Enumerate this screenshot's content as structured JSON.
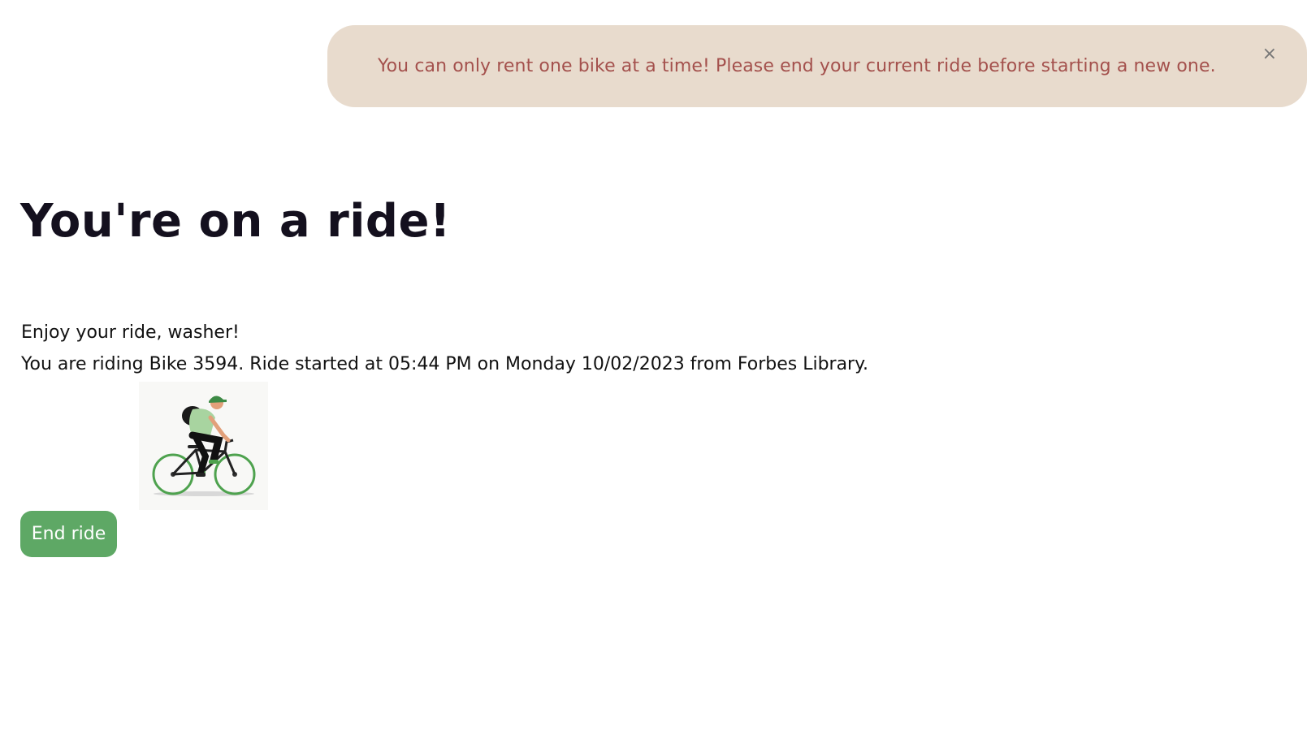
{
  "alert": {
    "message": "You can only rent one bike at a time! Please end your current ride before starting a new one.",
    "close_symbol": "×",
    "close_icon": "close-icon"
  },
  "main": {
    "title": "You're on a ride!",
    "greeting": "Enjoy your ride, washer!",
    "ride_info": "You are riding Bike 3594. Ride started at 05:44 PM on Monday 10/02/2023 from Forbes Library.",
    "end_ride_label": "End ride",
    "illustration": "cyclist-illustration"
  },
  "colors": {
    "alert_bg": "#e8dbcd",
    "alert_text": "#a4514d",
    "button_bg": "#5ea865",
    "title_text": "#14101e"
  }
}
